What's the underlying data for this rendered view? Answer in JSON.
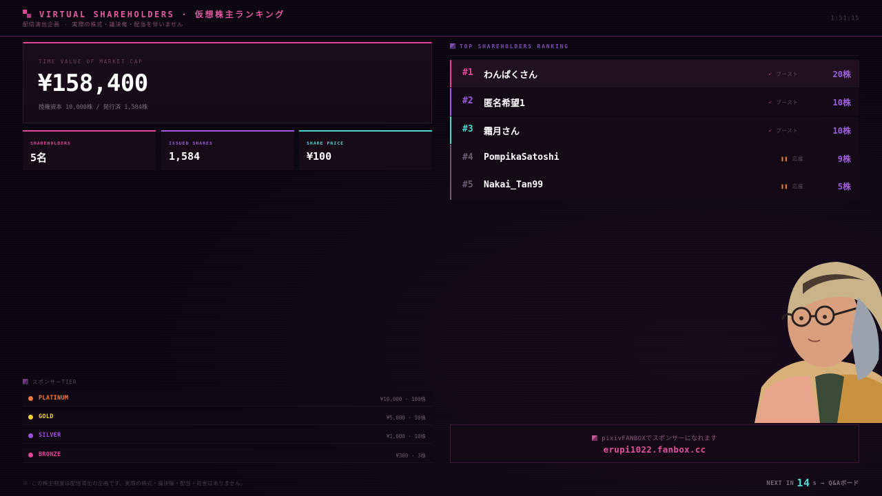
{
  "header": {
    "title": "VIRTUAL SHAREHOLDERS · 仮想株主ランキング",
    "subtitle": "配信演出企画 - 実際の株式・議決権・配当を伴いません",
    "clock": "1:51:15"
  },
  "market_cap": {
    "label": "TIME VALUE OF MARKET CAP",
    "value": "¥158,400",
    "sub": "授権資本 10,000株 / 発行済 1,584株"
  },
  "stats": [
    {
      "label": "SHAREHOLDERS",
      "value": "5名",
      "color": "#e0479a"
    },
    {
      "label": "ISSUED SHARES",
      "value": "1,584",
      "color": "#a05ae0"
    },
    {
      "label": "SHARE PRICE",
      "value": "¥100",
      "color": "#4fd6d0"
    }
  ],
  "tiers": {
    "heading": "スポンサーTIER",
    "rows": [
      {
        "name": "PLATINUM",
        "price": "¥10,000 · 100株",
        "color": "#f07a3a"
      },
      {
        "name": "GOLD",
        "price": "¥5,000 · 50株",
        "color": "#f2d23a"
      },
      {
        "name": "SILVER",
        "price": "¥1,000 · 10株",
        "color": "#a24fe0"
      },
      {
        "name": "BRONZE",
        "price": "¥300 · 3株",
        "color": "#e0479a"
      }
    ]
  },
  "disclaimer": "※ この株主制度は配信演出の企画です。実際の株式・議決権・配当・返金はありません。",
  "ranking": {
    "heading": "TOP SHAREHOLDERS RANKING",
    "rows": [
      {
        "rank": "#1",
        "name": "わんぱくさん",
        "badge": "ブースト",
        "badge_icon": "rocket-icon",
        "shares": "20株",
        "color": "#e0479a"
      },
      {
        "rank": "#2",
        "name": "匿名希望1",
        "badge": "ブースト",
        "badge_icon": "rocket-icon",
        "shares": "10株",
        "color": "#a05ae0"
      },
      {
        "rank": "#3",
        "name": "霜月さん",
        "badge": "ブースト",
        "badge_icon": "rocket-icon",
        "shares": "10株",
        "color": "#4fd6d0"
      },
      {
        "rank": "#4",
        "name": "PompikaSatoshi",
        "badge": "応援",
        "badge_icon": "pause-icon",
        "shares": "9株",
        "color": "#6b5a70"
      },
      {
        "rank": "#5",
        "name": "Nakai_Tan99",
        "badge": "応援",
        "badge_icon": "pause-icon",
        "shares": "5株",
        "color": "#6b5a70"
      }
    ]
  },
  "fanbox": {
    "line1": "pixivFANBOXでスポンサーになれます",
    "line2": "erupi1022.fanbox.cc"
  },
  "next": {
    "prefix": "NEXT IN",
    "count": "14",
    "suffix": "s → Q&Aボード"
  }
}
